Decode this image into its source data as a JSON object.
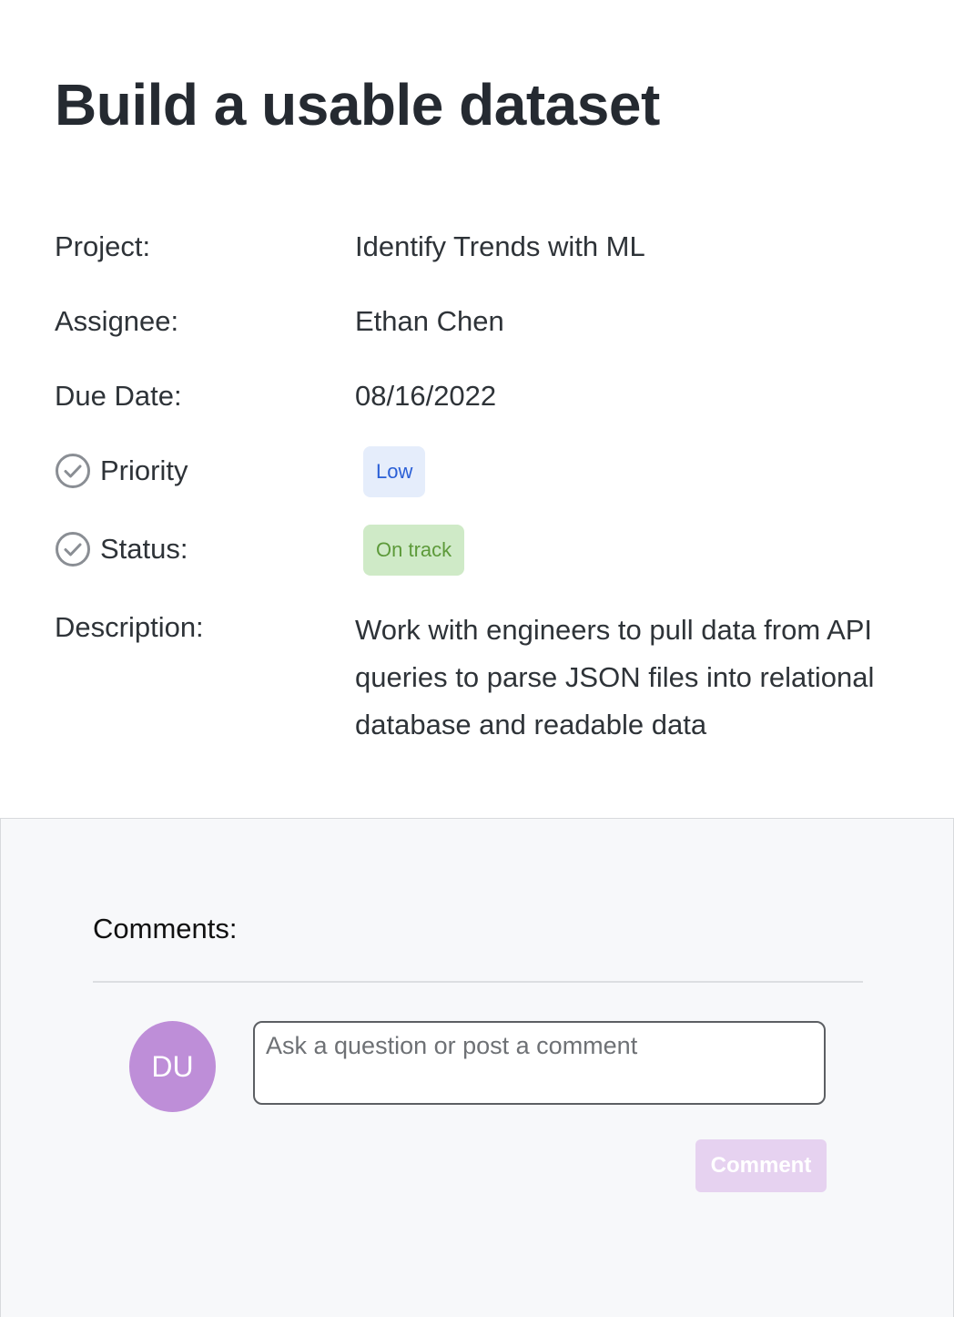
{
  "task": {
    "title": "Build a usable dataset"
  },
  "fields": {
    "project": {
      "label": "Project:",
      "value": "Identify Trends with ML"
    },
    "assignee": {
      "label": "Assignee:",
      "value": "Ethan Chen"
    },
    "due_date": {
      "label": "Due Date:",
      "value": "08/16/2022"
    },
    "priority": {
      "label": "Priority",
      "value": "Low",
      "icon": "check-circle-icon",
      "color": "#2a5fd6",
      "background": "#e5edfb"
    },
    "status": {
      "label": "Status:",
      "value": "On track",
      "icon": "check-circle-icon",
      "color": "#5d9a3a",
      "background": "#cfeac7"
    },
    "description": {
      "label": "Description:",
      "value": "Work with engineers to pull data from API queries to parse JSON files into relational database and readable data"
    }
  },
  "comments": {
    "label": "Comments:",
    "avatar_initials": "DU",
    "avatar_color": "#be8ed8",
    "input_placeholder": "Ask a question or post a comment",
    "input_value": "",
    "button_label": "Comment",
    "button_color": "#e6d2f0"
  }
}
